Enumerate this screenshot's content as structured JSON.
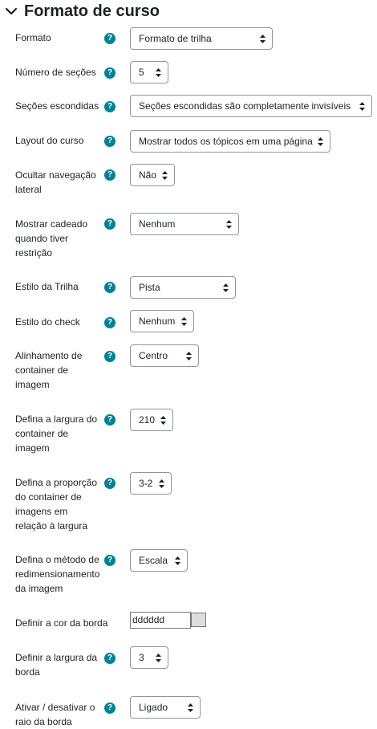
{
  "section": {
    "title": "Formato de curso"
  },
  "fields": [
    {
      "label": "Formato",
      "value": "Formato de trilha"
    },
    {
      "label": "Número de seções",
      "value": "5"
    },
    {
      "label": "Seções escondidas",
      "value": "Seções escondidas são completamente invisíveis"
    },
    {
      "label": "Layout do curso",
      "value": "Mostrar todos os tópicos em uma página"
    },
    {
      "label": "Ocultar navegação lateral",
      "value": "Não"
    },
    {
      "label": "Mostrar cadeado quando tiver restrição",
      "value": "Nenhum"
    },
    {
      "label": "Estilo da Trilha",
      "value": "Pista"
    },
    {
      "label": "Estilo do check",
      "value": "Nenhum"
    },
    {
      "label": "Alinhamento de container de imagem",
      "value": "Centro"
    },
    {
      "label": "Defina a largura do container de imagem",
      "value": "210"
    },
    {
      "label": "Defina a proporção do container de imagens em relação à largura",
      "value": "3-2"
    },
    {
      "label": "Defina o método de redimensionamento da imagem",
      "value": "Escala"
    },
    {
      "label": "Definir a cor da borda",
      "value": "dddddd"
    },
    {
      "label": "Definir a largura da borda",
      "value": "3"
    },
    {
      "label": "Ativar / desativar o raio da borda",
      "value": "Ligado"
    }
  ],
  "help_icon": "?",
  "icons": {
    "section_toggle": "chevron-down-icon",
    "help": "question-circle-icon",
    "select_arrows": "up-down-arrows-icon"
  },
  "colors": {
    "help": "#008196",
    "swatch": "#dddddd",
    "text": "#1d2125"
  }
}
